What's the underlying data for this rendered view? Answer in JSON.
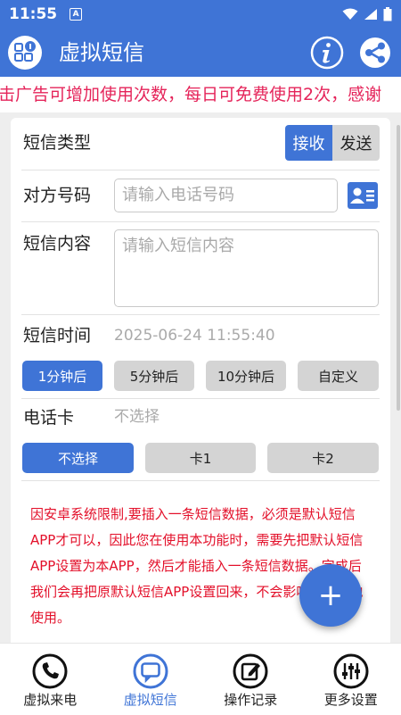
{
  "status_bar": {
    "time": "11:55",
    "notif_icon": "A"
  },
  "app_bar": {
    "title": "虚拟短信"
  },
  "marquee": {
    "text": "击广告可增加使用次数，每日可免费使用2次，感谢"
  },
  "form": {
    "sms_type": {
      "label": "短信类型",
      "options": [
        "接收",
        "发送"
      ],
      "selected": "接收"
    },
    "peer_number": {
      "label": "对方号码",
      "placeholder": "请输入电话号码"
    },
    "sms_content": {
      "label": "短信内容",
      "placeholder": "请输入短信内容"
    },
    "sms_time": {
      "label": "短信时间",
      "value": "2025-06-24 11:55:40",
      "presets": [
        "1分钟后",
        "5分钟后",
        "10分钟后",
        "自定义"
      ],
      "selected": "1分钟后"
    },
    "sim_card": {
      "label": "电话卡",
      "value": "不选择",
      "options": [
        "不选择",
        "卡1",
        "卡2"
      ],
      "selected": "不选择"
    }
  },
  "notice": {
    "text": "因安卓系统限制,要插入一条短信数据，必须是默认短信APP才可以，因此您在使用本功能时，需要先把默认短信APP设置为本APP，然后才能插入一条短信数据。完成后我们会再把原默认短信APP设置回来，不会影响您的其他使用。"
  },
  "fab": {
    "label": "+"
  },
  "bottom_nav": {
    "items": [
      {
        "label": "虚拟来电",
        "icon": "phone-icon"
      },
      {
        "label": "虚拟短信",
        "icon": "message-icon"
      },
      {
        "label": "操作记录",
        "icon": "edit-note-icon"
      },
      {
        "label": "更多设置",
        "icon": "sliders-icon"
      }
    ],
    "active": "虚拟短信"
  },
  "colors": {
    "primary": "#3f74d6",
    "marquee_text": "#e5245a",
    "notice_text": "#e3102a"
  }
}
